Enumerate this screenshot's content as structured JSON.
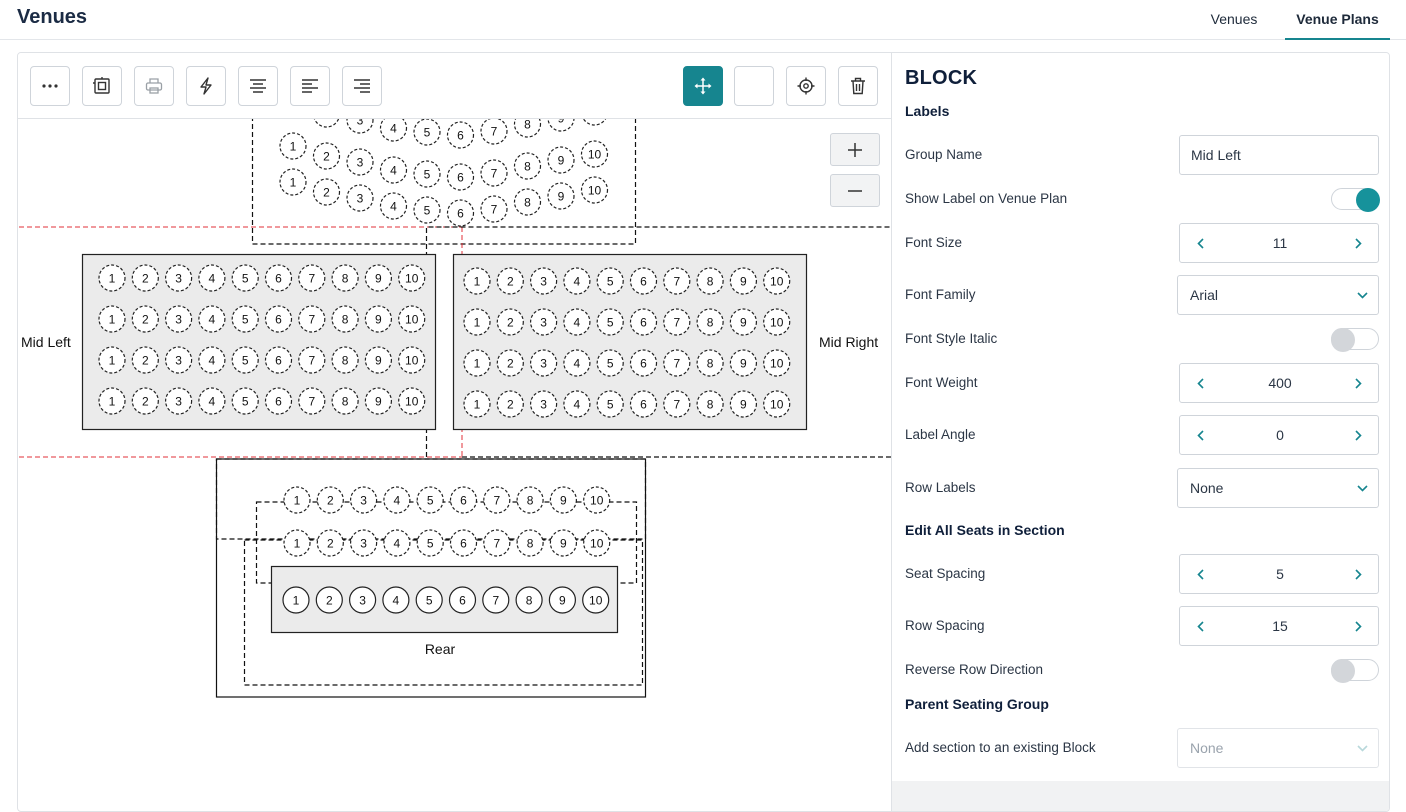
{
  "header": {
    "title": "Venues",
    "tabs": [
      {
        "label": "Venues",
        "active": false
      },
      {
        "label": "Venue Plans",
        "active": true
      }
    ]
  },
  "toolbar": {
    "buttons": [
      {
        "name": "more-options",
        "icon": "ellipsis-icon"
      },
      {
        "name": "select-area",
        "icon": "select-area-icon"
      },
      {
        "name": "print",
        "icon": "printer-icon"
      },
      {
        "name": "quick-action",
        "icon": "lightning-icon"
      },
      {
        "name": "align-center",
        "icon": "align-center-icon"
      },
      {
        "name": "align-left",
        "icon": "align-left-icon"
      },
      {
        "name": "align-right",
        "icon": "align-right-icon"
      },
      {
        "name": "move-tool",
        "icon": "move-icon",
        "active": true
      },
      {
        "name": "blank-tool",
        "icon": ""
      },
      {
        "name": "target-tool",
        "icon": "crosshair-icon"
      },
      {
        "name": "delete",
        "icon": "trash-icon"
      }
    ],
    "accent": "#16858f"
  },
  "zoom": {
    "in_icon": "plus-icon",
    "out_icon": "minus-icon"
  },
  "plan": {
    "seat_numbers": [
      "1",
      "2",
      "3",
      "4",
      "5",
      "6",
      "7",
      "8",
      "9",
      "10"
    ],
    "labels": {
      "mid_left": "Mid Left",
      "mid_right": "Mid Right",
      "rear": "Rear"
    }
  },
  "props": {
    "title": "BLOCK",
    "labels_heading": "Labels",
    "group_name": {
      "label": "Group Name",
      "value": "Mid Left"
    },
    "show_label": {
      "label": "Show Label on Venue Plan",
      "on": true
    },
    "font_size": {
      "label": "Font Size",
      "value": "11"
    },
    "font_family": {
      "label": "Font Family",
      "value": "Arial"
    },
    "font_italic": {
      "label": "Font Style Italic",
      "on": false
    },
    "font_weight": {
      "label": "Font Weight",
      "value": "400"
    },
    "label_angle": {
      "label": "Label Angle",
      "value": "0"
    },
    "row_labels": {
      "label": "Row Labels",
      "value": "None"
    },
    "edit_heading": "Edit All Seats in Section",
    "seat_spacing": {
      "label": "Seat Spacing",
      "value": "5"
    },
    "row_spacing": {
      "label": "Row Spacing",
      "value": "15"
    },
    "reverse_row": {
      "label": "Reverse Row Direction",
      "on": false
    },
    "parent_heading": "Parent Seating Group",
    "existing_block": {
      "label": "Add section to an existing Block",
      "value": "None"
    },
    "toggle_color": "#16929b"
  }
}
